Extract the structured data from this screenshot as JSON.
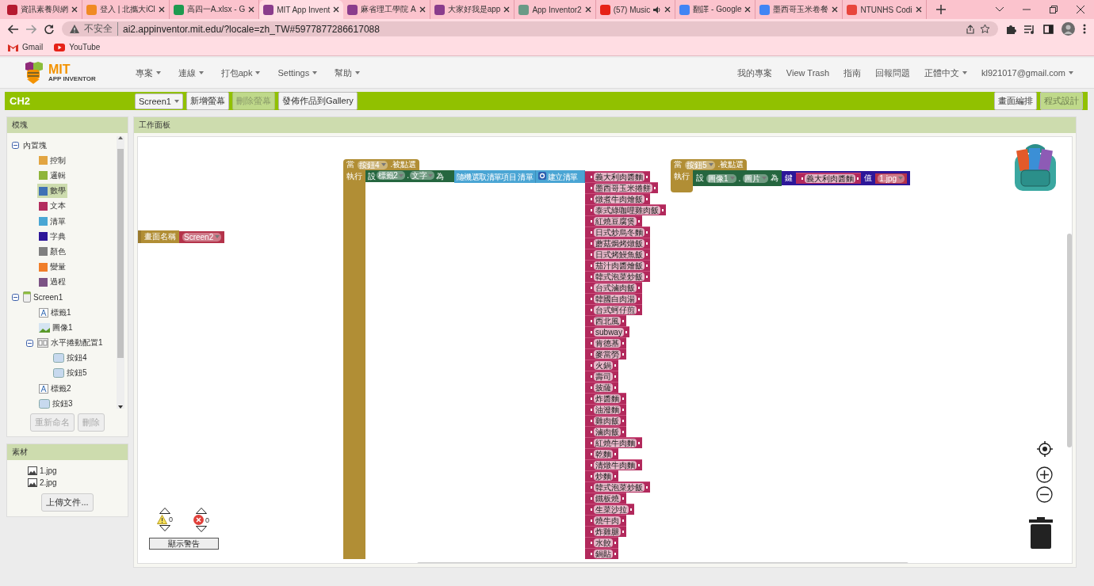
{
  "browser": {
    "tabs": [
      {
        "title": "資訊素養與網",
        "color": "#b5192f",
        "selected": false,
        "audio": false
      },
      {
        "title": "登入 | 北攜大iCl",
        "color": "#f08a24",
        "selected": false,
        "audio": false
      },
      {
        "title": "高四一A.xlsx - G",
        "color": "#1e9a4f",
        "selected": false,
        "audio": false
      },
      {
        "title": "MIT App Invent",
        "color": "#8a3c8c",
        "selected": true,
        "audio": false
      },
      {
        "title": "麻省理工學院 A",
        "color": "#8a3c8c",
        "selected": false,
        "audio": false
      },
      {
        "title": "大家好我是app",
        "color": "#8a3c8c",
        "selected": false,
        "audio": false
      },
      {
        "title": "App Inventor2",
        "color": "#6a9a86",
        "selected": false,
        "audio": false
      },
      {
        "title": "(57) Music",
        "color": "#e62117",
        "selected": false,
        "audio": true
      },
      {
        "title": "翻譯 - Google",
        "color": "#4285f4",
        "selected": false,
        "audio": false
      },
      {
        "title": "墨西哥玉米卷餐",
        "color": "#4285f4",
        "selected": false,
        "audio": false
      },
      {
        "title": "NTUNHS Codi",
        "color": "#e8453c",
        "selected": false,
        "audio": false
      }
    ],
    "security": "不安全",
    "url": "ai2.appinventor.mit.edu/?locale=zh_TW#5977877286617088",
    "bookmarks": [
      {
        "label": "Gmail",
        "kind": "gmail"
      },
      {
        "label": "YouTube",
        "kind": "youtube"
      }
    ]
  },
  "app": {
    "logo_title": "MIT",
    "logo_subtitle": "APP INVENTOR",
    "menus": [
      {
        "label": "專案",
        "dropdown": true
      },
      {
        "label": "連線",
        "dropdown": true
      },
      {
        "label": "打包apk",
        "dropdown": true
      },
      {
        "label": "Settings",
        "dropdown": true
      },
      {
        "label": "幫助",
        "dropdown": true
      }
    ],
    "right_menus": [
      {
        "label": "我的專案",
        "dropdown": false
      },
      {
        "label": "View Trash",
        "dropdown": false
      },
      {
        "label": "指南",
        "dropdown": false
      },
      {
        "label": "回報問題",
        "dropdown": false
      },
      {
        "label": "正體中文",
        "dropdown": true
      },
      {
        "label": "kl921017@gmail.com",
        "dropdown": true
      }
    ]
  },
  "project": {
    "name": "CH2",
    "screen": "Screen1",
    "buttons": [
      {
        "label": "新增螢幕",
        "disabled": false
      },
      {
        "label": "刪除螢幕",
        "disabled": true
      },
      {
        "label": "發佈作品到Gallery",
        "disabled": false
      }
    ],
    "views": [
      {
        "label": "畫面編排",
        "selected": false
      },
      {
        "label": "程式設計",
        "selected": true
      }
    ]
  },
  "blocks_panel": {
    "title": "模塊",
    "tree": [
      {
        "label": "內置塊",
        "kind": "folder",
        "expanded": true,
        "selected": false,
        "children": [
          {
            "label": "控制",
            "kind": "category",
            "color": "#e2a542",
            "selected": false
          },
          {
            "label": "邏輯",
            "kind": "category",
            "color": "#8fb53a",
            "selected": false
          },
          {
            "label": "數學",
            "kind": "category",
            "color": "#3f71b5",
            "selected": true
          },
          {
            "label": "文本",
            "kind": "category",
            "color": "#b32d5e",
            "selected": false
          },
          {
            "label": "清單",
            "kind": "category",
            "color": "#49a6d4",
            "selected": false
          },
          {
            "label": "字典",
            "kind": "category",
            "color": "#2d1799",
            "selected": false
          },
          {
            "label": "顏色",
            "kind": "category",
            "color": "#7f7f7f",
            "selected": false
          },
          {
            "label": "變量",
            "kind": "category",
            "color": "#f07e2a",
            "selected": false
          },
          {
            "label": "過程",
            "kind": "category",
            "color": "#7c5385",
            "selected": false
          }
        ]
      },
      {
        "label": "Screen1",
        "kind": "screen",
        "expanded": true,
        "selected": false,
        "children": [
          {
            "label": "標籤1",
            "kind": "label",
            "selected": false
          },
          {
            "label": "圖像1",
            "kind": "image",
            "selected": false
          },
          {
            "label": "水平捲動配置1",
            "kind": "arrangement",
            "expanded": true,
            "selected": false,
            "children": [
              {
                "label": "按鈕4",
                "kind": "button",
                "selected": false
              },
              {
                "label": "按鈕5",
                "kind": "button",
                "selected": false
              }
            ]
          },
          {
            "label": "標籤2",
            "kind": "label",
            "selected": false
          },
          {
            "label": "按鈕3",
            "kind": "button",
            "selected": false
          }
        ]
      }
    ],
    "buttons": [
      {
        "label": "重新命名",
        "disabled": true
      },
      {
        "label": "刪除",
        "disabled": true
      }
    ]
  },
  "media_panel": {
    "title": "素材",
    "files": [
      "1.jpg",
      "2.jpg"
    ],
    "upload": "上傳文件..."
  },
  "workspace": {
    "title": "工作面板",
    "screen_block": {
      "label": "畫面名稱",
      "value": "Screen2"
    },
    "event_1": {
      "when": "當",
      "component": "按鈕4",
      "event": ".被點選",
      "do": "執行",
      "set": "設",
      "target": "標籤2",
      "dot": ".",
      "property": "文字",
      "to": "為",
      "pick": "隨機選取清單項目",
      "pick_arg": "清單",
      "make": "建立清單",
      "items": [
        "義大利肉醬麵",
        "墨西哥玉米捲餅",
        "燉煮牛肉燴飯",
        "泰式綠咖哩雞肉飯",
        "紅燒豆腐煲",
        "日式炒烏冬麵",
        "蘑菇焗烤燉飯",
        "日式烤鰻魚飯",
        "茄汁肉醬燴飯",
        "韓式泡菜炒飯",
        "台式滷肉飯",
        "韓國白肉湯",
        "台式蚵仔煎",
        "西北風",
        "subway",
        "肯德基",
        "麥當勞",
        "火鍋",
        "壽司",
        "披薩",
        "炸醬麵",
        "油潑麵",
        "雞肉飯",
        "滷肉飯",
        "紅燒牛肉麵",
        "乾麵",
        "清燉牛肉麵",
        "炒麵",
        "韓式泡菜炒飯",
        "鐵板燒",
        "生菜沙拉",
        "燒牛肉",
        "炸雞腿",
        "水餃",
        "鍋貼"
      ]
    },
    "event_2": {
      "when": "當",
      "component": "按鈕5",
      "event": ".被點選",
      "do": "執行",
      "set": "設",
      "target": "圖像1",
      "dot": ".",
      "property": "圖片",
      "to": "為",
      "key_label": "鍵",
      "key": "義大利肉醬麵",
      "value_label": "值",
      "value": "1.jpg"
    },
    "warnings": {
      "warning_count": "0",
      "error_count": "0",
      "toggle": "顯示警告"
    }
  }
}
